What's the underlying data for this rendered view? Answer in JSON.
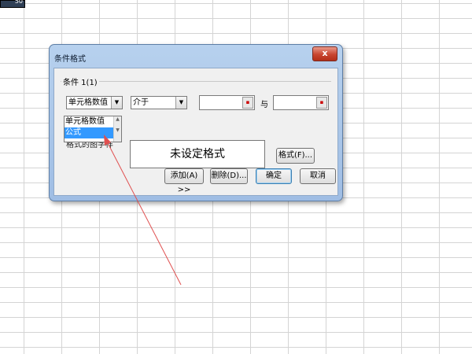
{
  "sheet": {
    "cell_value": "50"
  },
  "dialog": {
    "title": "条件格式",
    "close_symbol": "x",
    "group_label": "条件 1(1)",
    "condition_type": "单元格数值",
    "operator": "介于",
    "value1": "",
    "value2": "",
    "and_label": "与",
    "dropdown_options": [
      "单元格数值",
      "公式"
    ],
    "dropdown_selected_index": 1,
    "hidden_text": "格式的图字样",
    "preview_text": "未设定格式",
    "format_button": "格式(F)...",
    "add_button": "添加(A) >>",
    "delete_button": "删除(D)...",
    "ok_button": "确定",
    "cancel_button": "取消"
  },
  "icons": {
    "dropdown_arrow": "chevron-down-icon",
    "range_select": "range-select-icon",
    "close": "close-icon"
  },
  "colors": {
    "title_bar": "#b7d1ee",
    "close_button": "#c8452f",
    "selection": "#3399ff",
    "annotation_arrow": "#e05050"
  }
}
